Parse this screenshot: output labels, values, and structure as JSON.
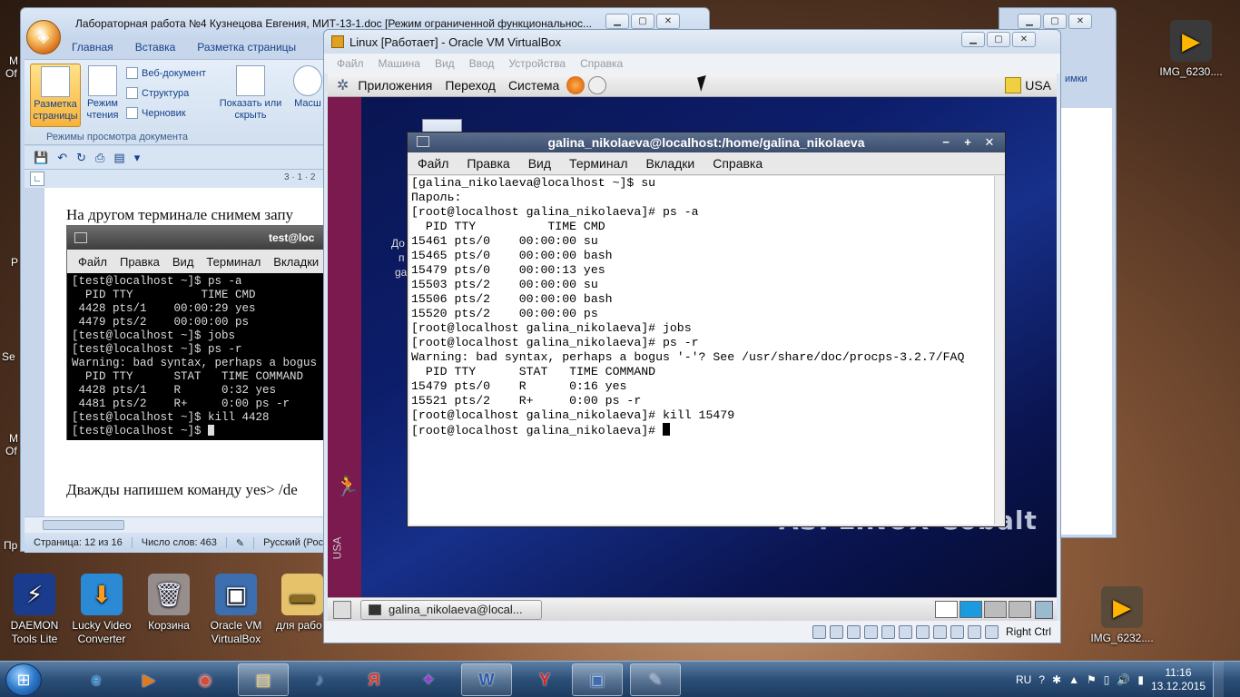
{
  "desktop": {
    "icons": [
      {
        "label": "DAEMON Tools Lite",
        "icon": "daemon-tools-icon"
      },
      {
        "label": "Lucky Video Converter",
        "icon": "video-converter-icon"
      },
      {
        "label": "Корзина",
        "icon": "recycle-bin-icon"
      },
      {
        "label": "Oracle VM VirtualBox",
        "icon": "virtualbox-icon"
      },
      {
        "label": "для рабо",
        "icon": "folder-icon"
      }
    ],
    "right_icons": [
      {
        "label": "IMG_6230....",
        "icon": "video-file-icon"
      },
      {
        "label": "IMG_6232....",
        "icon": "video-file-icon"
      }
    ],
    "left_partial": [
      "М",
      "Of",
      "Р",
      "Se",
      "М",
      "Of",
      "Пр"
    ]
  },
  "word": {
    "title": "Лабораторная работа №4 Кузнецова Евгения, МИТ-13-1.doc [Режим ограниченной функциональнос...",
    "tabs": [
      "Главная",
      "Вставка",
      "Разметка страницы"
    ],
    "ribbon": {
      "page_layout": "Разметка страницы",
      "reading_mode": "Режим чтения",
      "web_doc": "Веб-документ",
      "structure": "Структура",
      "draft": "Черновик",
      "show_hide": "Показать или скрыть",
      "zoom": "Масш",
      "group_label": "Режимы просмотра документа"
    },
    "ruler_text": "3 · 1 · 2",
    "doc": {
      "line1": "На другом терминале снимем запу",
      "line2": "Дважды напишем команду yes> /de"
    },
    "embedded_terminal": {
      "title": "test@loc",
      "menu": [
        "Файл",
        "Правка",
        "Вид",
        "Терминал",
        "Вкладки"
      ],
      "lines": [
        "[test@localhost ~]$ ps -a",
        "  PID TTY          TIME CMD",
        " 4428 pts/1    00:00:29 yes",
        " 4479 pts/2    00:00:00 ps",
        "[test@localhost ~]$ jobs",
        "[test@localhost ~]$ ps -r",
        "Warning: bad syntax, perhaps a bogus",
        "  PID TTY      STAT   TIME COMMAND",
        " 4428 pts/1    R      0:32 yes",
        " 4481 pts/2    R+     0:00 ps -r",
        "[test@localhost ~]$ kill 4428",
        "[test@localhost ~]$ "
      ]
    },
    "status": {
      "page": "Страница: 12 из 16",
      "words": "Число слов: 463",
      "lang": "Русский (Росс"
    }
  },
  "bgwin": {
    "partial_text": "имки"
  },
  "vbox": {
    "title": "Linux [Работает] - Oracle VM VirtualBox",
    "menu": [
      "Файл",
      "Машина",
      "Вид",
      "Ввод",
      "Устройства",
      "Справка"
    ],
    "host_key": "Right Ctrl",
    "guest": {
      "panel": [
        "Приложения",
        "Переход",
        "Система"
      ],
      "keyboard": "USA",
      "side_label": "USA",
      "desktop_partial": [
        "До",
        "п",
        "ga"
      ],
      "logo_text": "ASPLINUX Cobalt",
      "task_label": "galina_nikolaeva@local..."
    }
  },
  "terminal": {
    "title": "galina_nikolaeva@localhost:/home/galina_nikolaeva",
    "menu": [
      "Файл",
      "Правка",
      "Вид",
      "Терминал",
      "Вкладки",
      "Справка"
    ],
    "lines": [
      "[galina_nikolaeva@localhost ~]$ su",
      "Пароль:",
      "[root@localhost galina_nikolaeva]# ps -a",
      "  PID TTY          TIME CMD",
      "15461 pts/0    00:00:00 su",
      "15465 pts/0    00:00:00 bash",
      "15479 pts/0    00:00:13 yes",
      "15503 pts/2    00:00:00 su",
      "15506 pts/2    00:00:00 bash",
      "15520 pts/2    00:00:00 ps",
      "[root@localhost galina_nikolaeva]# jobs",
      "[root@localhost galina_nikolaeva]# ps -r",
      "Warning: bad syntax, perhaps a bogus '-'? See /usr/share/doc/procps-3.2.7/FAQ",
      "  PID TTY      STAT   TIME COMMAND",
      "15479 pts/0    R      0:16 yes",
      "15521 pts/2    R+     0:00 ps -r",
      "[root@localhost galina_nikolaeva]# kill 15479",
      "[root@localhost galina_nikolaeva]# "
    ]
  },
  "taskbar": {
    "items": [
      {
        "icon": "internet-explorer-icon",
        "glyph": "e"
      },
      {
        "icon": "media-player-icon",
        "glyph": "▶"
      },
      {
        "icon": "chrome-icon",
        "glyph": "◉"
      },
      {
        "icon": "explorer-folder-icon",
        "glyph": "▤"
      },
      {
        "icon": "audio-icon",
        "glyph": "♪"
      },
      {
        "icon": "yandex-icon",
        "glyph": "Я"
      },
      {
        "icon": "rainmeter-icon",
        "glyph": "✦"
      },
      {
        "icon": "word-icon",
        "glyph": "W"
      },
      {
        "icon": "yandex-browser-icon",
        "glyph": "Y"
      },
      {
        "icon": "virtualbox-taskbar-icon",
        "glyph": "▣"
      },
      {
        "icon": "paint-icon",
        "glyph": "✎"
      }
    ],
    "lang": "RU",
    "time": "11:16",
    "date": "13.12.2015"
  }
}
